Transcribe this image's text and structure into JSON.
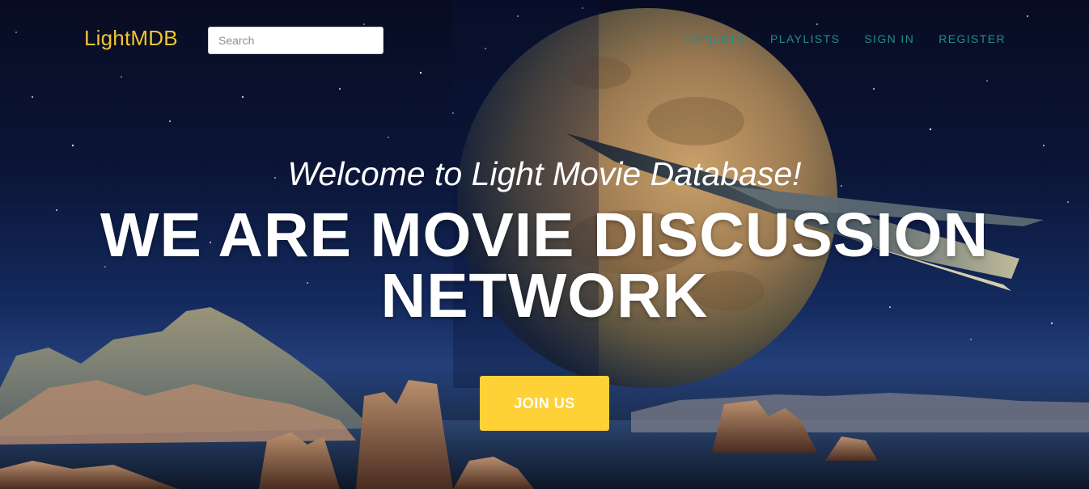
{
  "brand": {
    "name": "LightMDB",
    "color": "#f2c430"
  },
  "search": {
    "placeholder": "Search",
    "value": ""
  },
  "nav": {
    "items": [
      {
        "label": "TOPLISTS"
      },
      {
        "label": "PLAYLISTS"
      },
      {
        "label": "SIGN IN"
      },
      {
        "label": "REGISTER"
      }
    ],
    "link_color": "#1f8e8a"
  },
  "hero": {
    "welcome": "Welcome to Light Movie Database!",
    "headline_line1": "WE ARE MOVIE DISCUSSION",
    "headline_line2": "NETWORK",
    "cta_label": "JOIN US",
    "cta_color": "#fed136",
    "background": "space-planet-spaceship-alien-landscape"
  }
}
